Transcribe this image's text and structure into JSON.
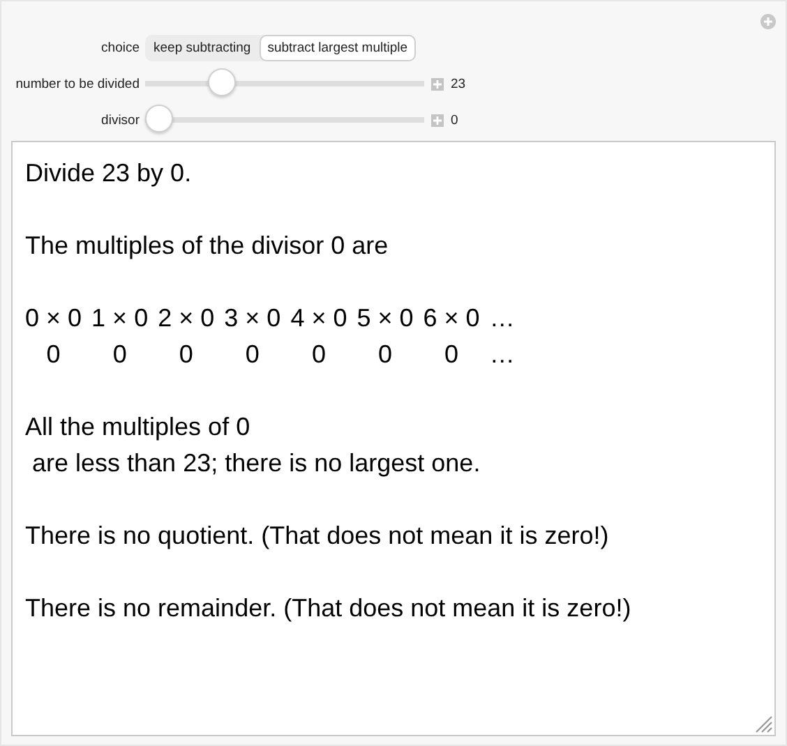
{
  "controls": {
    "choice": {
      "label": "choice",
      "options": [
        {
          "label": "keep subtracting",
          "selected": false
        },
        {
          "label": "subtract largest multiple",
          "selected": true
        }
      ]
    },
    "sliders": [
      {
        "label": "number to be divided",
        "level": 0.25,
        "reading": "23"
      },
      {
        "label": "divisor",
        "level": 0,
        "reading": "0"
      }
    ]
  },
  "output": {
    "intro": "Divide 23 by 0.",
    "multiples_heading": "The multiples of the divisor 0 are",
    "multiples": [
      {
        "product": "0 × 0",
        "value": "0"
      },
      {
        "product": "1 × 0",
        "value": "0"
      },
      {
        "product": "2 × 0",
        "value": "0"
      },
      {
        "product": "3 × 0",
        "value": "0"
      },
      {
        "product": "4 × 0",
        "value": "0"
      },
      {
        "product": "5 × 0",
        "value": "0"
      },
      {
        "product": "6 × 0",
        "value": "0"
      },
      {
        "product": "…",
        "value": "…"
      }
    ],
    "paragraphs": [
      [
        "All the multiples of 0",
        " are less than 23; there is no largest one."
      ],
      [
        "There is no quotient. (That does not mean it is zero!)"
      ],
      [
        "There is no remainder. (That does not mean it is zero!)"
      ]
    ]
  }
}
